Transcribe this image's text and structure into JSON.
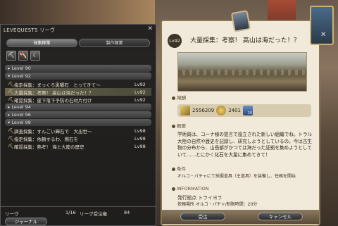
{
  "left_panel": {
    "title": "LEVEQUESTS リーヴ",
    "close_icon": "close-icon",
    "tabs": [
      {
        "label": "採集稼業",
        "active": true
      },
      {
        "label": "製作稼業",
        "active": false
      }
    ],
    "tools": [
      "pickaxe-icon",
      "hatchet-icon",
      "sickle-icon"
    ],
    "groups": [
      {
        "label": "Level 90",
        "quests": []
      },
      {
        "label": "Level 92",
        "quests": [
          {
            "icon": "quest-icon",
            "name": "指定採集：まっくろ黒曜石　とってきて〜",
            "level": "Lv92",
            "selected": false
          },
          {
            "icon": "quest-icon",
            "name": "大量採集：考察！ 高山は海だった！？",
            "level": "Lv92",
            "selected": true
          },
          {
            "icon": "quest-icon",
            "name": "確認採集：崖下落下予防の石材片付け",
            "level": "Lv92",
            "selected": false
          }
        ]
      },
      {
        "label": "Level 94",
        "quests": []
      },
      {
        "label": "Level 96",
        "quests": []
      },
      {
        "label": "Level 98",
        "quests": [
          {
            "icon": "quest-icon",
            "name": "調査採集：すんごい輝石で　大出世〜",
            "level": "Lv98",
            "selected": false
          },
          {
            "icon": "quest-icon",
            "name": "指定採集：依頼するわ、燃石を",
            "level": "Lv98",
            "selected": false
          },
          {
            "icon": "quest-icon",
            "name": "確認採集：熟考！ 海と大陸の歴史",
            "level": "Lv98",
            "selected": false
          }
        ]
      }
    ],
    "footer": {
      "label": "リーヴ",
      "count": "1/16",
      "allowance_label": "リーヴ受注権",
      "allowance": "84",
      "journal_button": "ジャーナル"
    }
  },
  "right_panel": {
    "level_badge": "Lv92",
    "quest_title": "大量採集：考察！ 高山は海だった！？",
    "reward_section": "報酬",
    "rewards": {
      "exp": "2556209",
      "gil": "2401",
      "seals": "10"
    },
    "details_section": "概要",
    "description": "学術員は、コーナ様の提言で設立された新しい組織でね。トラル大陸の自然や歴史を記録し、研究しようとしているの。今は古生物の分布から、山岳部がかつては海だった証拠を集めようとしていて……とにかく化石を大量に集めてきて！",
    "requirements_section": "条件",
    "requirements": "オルコ・パチャにて採掘道具（主道具）を装備し、任務を開始",
    "information_section": "INFORMATION",
    "info_line1": "発行拠点 トライヨラ",
    "info_line2": "依頼場所 オルコ・パチャ/制限時間：20分",
    "accept_button": "受注",
    "cancel_button": "キャンセル"
  }
}
